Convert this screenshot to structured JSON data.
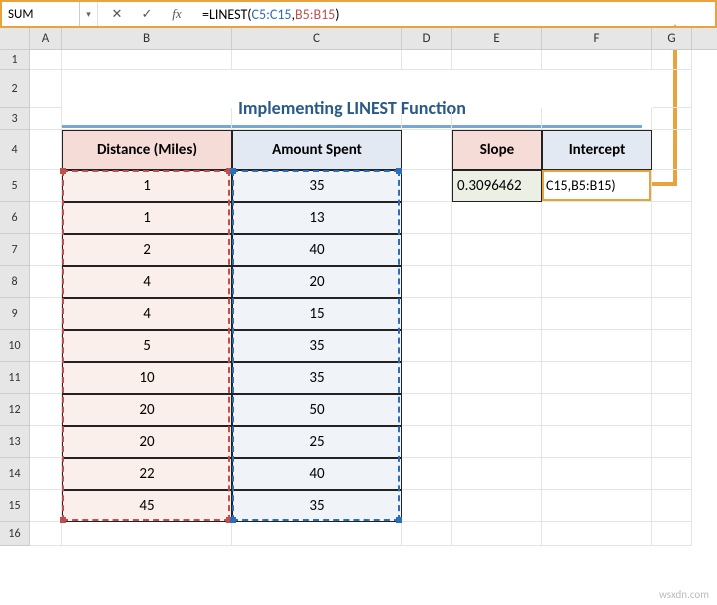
{
  "name_box": "SUM",
  "formula": {
    "prefix": "=",
    "fn": "LINEST",
    "open": "(",
    "ref1": "C5:C15",
    "comma": ",",
    "ref2": "B5:B15",
    "close": ")"
  },
  "columns": [
    "A",
    "B",
    "C",
    "D",
    "E",
    "F",
    "G"
  ],
  "rows": [
    "1",
    "2",
    "3",
    "4",
    "5",
    "6",
    "7",
    "8",
    "9",
    "10",
    "11",
    "12",
    "13",
    "14",
    "15",
    "16"
  ],
  "title": "Implementing LINEST Function",
  "headers": {
    "B": "Distance (Miles)",
    "C": "Amount Spent",
    "E": "Slope",
    "F": "Intercept"
  },
  "data": {
    "B": [
      "1",
      "1",
      "2",
      "4",
      "4",
      "5",
      "10",
      "20",
      "20",
      "22",
      "45"
    ],
    "C": [
      "35",
      "13",
      "40",
      "20",
      "15",
      "35",
      "35",
      "50",
      "25",
      "40",
      "35"
    ]
  },
  "results": {
    "E5": "0.3096462",
    "F5_display": "C15,B5:B15)"
  },
  "watermark": "wsxdn.com",
  "icons": {
    "dropdown": "▾",
    "cancel": "✕",
    "enter": "✓",
    "fx": "fx"
  }
}
